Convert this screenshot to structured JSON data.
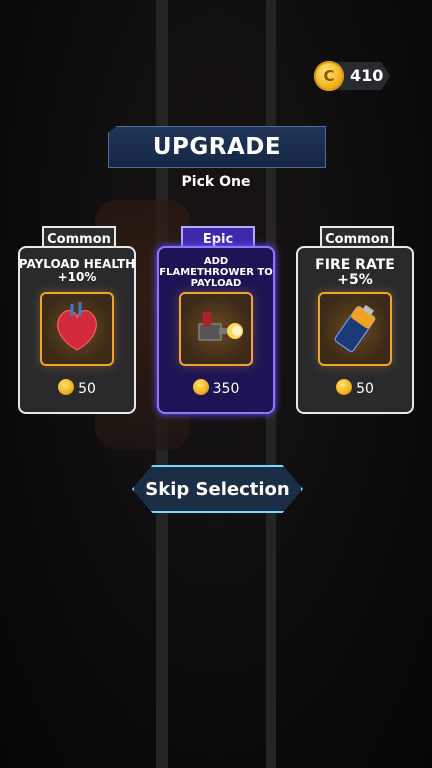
{
  "coins": {
    "value": "410"
  },
  "header": {
    "title": "UPGRADE",
    "subtitle": "Pick One"
  },
  "cards": [
    {
      "tier": "Common",
      "name": "PAYLOAD HEALTH +10%",
      "price": "50"
    },
    {
      "tier": "Epic",
      "name": "ADD FLAMETHROWER TO PAYLOAD",
      "price": "350"
    },
    {
      "tier": "Common",
      "name": "FIRE RATE +5%",
      "price": "50"
    }
  ],
  "skip": {
    "label": "Skip Selection"
  },
  "icons": {
    "coin": "coin-icon",
    "heart": "heart-icon",
    "flamethrower": "flamethrower-icon",
    "battery": "battery-icon"
  }
}
